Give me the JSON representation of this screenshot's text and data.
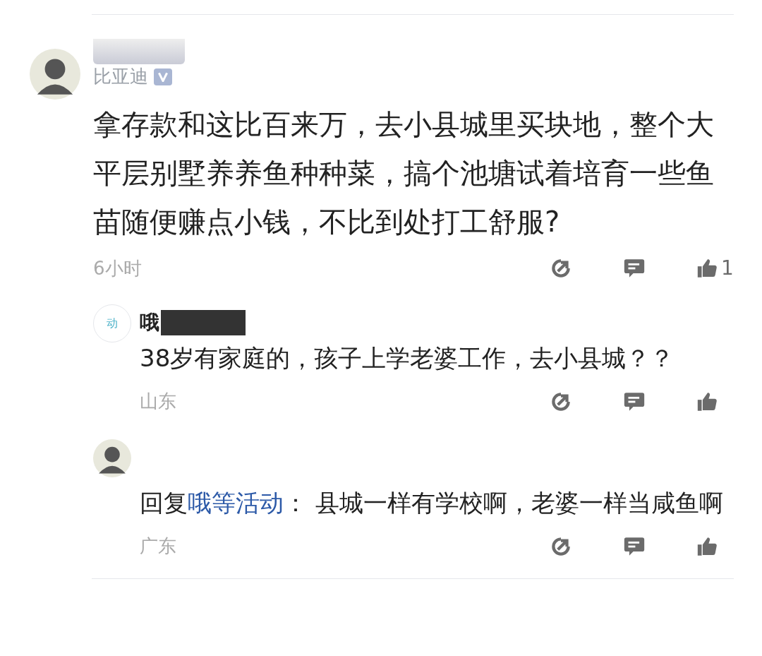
{
  "comment": {
    "author": "比亚迪",
    "redacted": true,
    "verified": true,
    "text": "拿存款和这比百来万，去小县城里买块地，整个大平层别墅养养鱼种种菜，搞个池塘试着培育一些鱼苗随便赚点小钱，不比到处打工舒服?",
    "time": "6小时",
    "likes": "1"
  },
  "replies": [
    {
      "avatar": {
        "kind": "text",
        "label": "动"
      },
      "author": "哦",
      "redacted": true,
      "text": "38岁有家庭的，孩子上学老婆工作，去小县城？？",
      "location": "山东"
    },
    {
      "reply_prefix": "回复",
      "reply_to": "哦等活动",
      "text": "： 县城一样有学校啊，老婆一样当咸鱼啊",
      "location": "广东"
    }
  ]
}
